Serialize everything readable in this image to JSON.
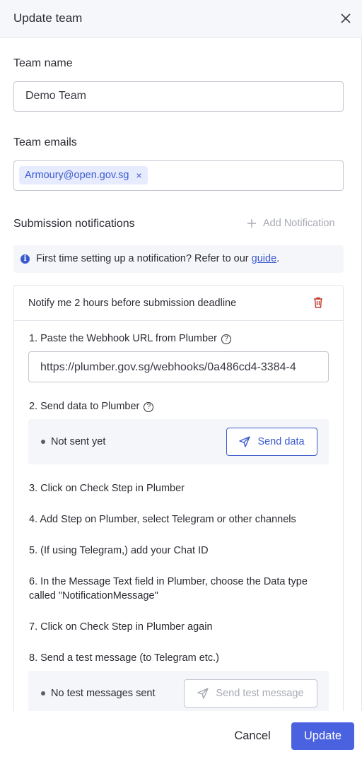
{
  "header": {
    "title": "Update team",
    "close_icon": "close-icon"
  },
  "team_name": {
    "label": "Team name",
    "value": "Demo Team"
  },
  "team_emails": {
    "label": "Team emails",
    "chips": [
      "Armoury@open.gov.sg"
    ],
    "remove_glyph": "×"
  },
  "notifications": {
    "label": "Submission notifications",
    "add_label": "Add Notification",
    "info_text": "First time setting up a notification? Refer to our ",
    "info_link": "guide",
    "info_suffix": "."
  },
  "card": {
    "title": "Notify me 2 hours before submission deadline",
    "steps": [
      "1. Paste the Webhook URL from Plumber",
      "2. Send data to Plumber",
      "3. Click on Check Step in Plumber",
      "4. Add Step on Plumber, select Telegram or other channels",
      "5. (If using Telegram,) add your Chat ID",
      "6. In the Message Text field in Plumber, choose the Data type called \"NotificationMessage\"",
      "7. Click on Check Step in Plumber again",
      "8. Send a test message (to Telegram etc.)"
    ],
    "webhook_url": "https://plumber.gov.sg/webhooks/0a486cd4-3384-4",
    "send_status": "Not sent yet",
    "send_button": "Send data",
    "test_status": "No test messages sent",
    "test_button": "Send test message"
  },
  "footer": {
    "cancel": "Cancel",
    "update": "Update"
  },
  "colors": {
    "accent": "#4a61e0",
    "link": "#3c5ad0",
    "danger": "#c0392b"
  }
}
